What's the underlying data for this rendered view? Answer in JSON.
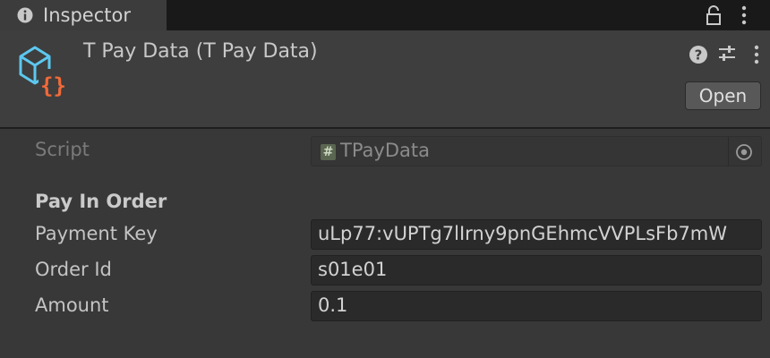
{
  "tab": {
    "title": "Inspector",
    "icons": [
      "info-icon",
      "lock-icon",
      "more-vertical-icon"
    ]
  },
  "header": {
    "asset_title": "T Pay Data (T Pay Data)",
    "asset_icon": "scriptable-object-icon",
    "icons": [
      "help-icon",
      "preset-icon",
      "more-vertical-icon"
    ],
    "open_label": "Open"
  },
  "script_row": {
    "label": "Script",
    "value": "TPayData",
    "icons": [
      "cs-script-icon",
      "object-picker-icon"
    ]
  },
  "section": {
    "title": "Pay In Order"
  },
  "fields": [
    {
      "label": "Payment Key",
      "value": "uLp77:vUPTg7lIrny9pnGEhmcVVPLsFb7mW"
    },
    {
      "label": "Order Id",
      "value": "s01e01"
    },
    {
      "label": "Amount",
      "value": "0.1"
    }
  ],
  "colors": {
    "background": "#383838",
    "tabbar": "#191919",
    "field_background": "#2a2a2a",
    "icon_blue": "#5cc8f0",
    "icon_orange": "#f06a3a"
  }
}
